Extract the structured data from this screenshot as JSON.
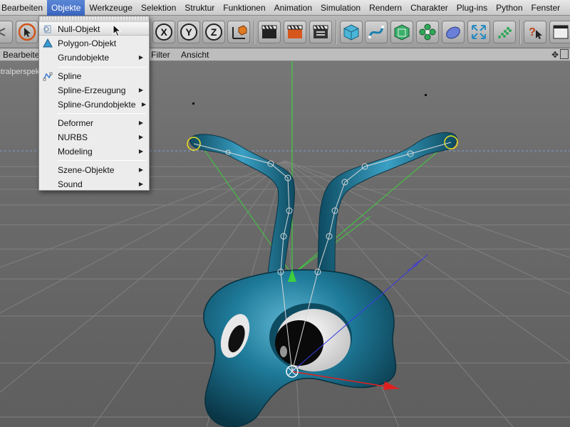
{
  "menubar": {
    "items": [
      "Bearbeiten",
      "Objekte",
      "Werkzeuge",
      "Selektion",
      "Struktur",
      "Funktionen",
      "Animation",
      "Simulation",
      "Rendern",
      "Charakter",
      "Plug-ins",
      "Python",
      "Fenster"
    ]
  },
  "viewport_menu": {
    "items": [
      "Bearbeite",
      "Filter",
      "Ansicht"
    ]
  },
  "viewport": {
    "label": "Zentralperspektive"
  },
  "axis_buttons": [
    "X",
    "Y",
    "Z"
  ],
  "objects_menu": {
    "items": [
      {
        "label": "Null-Objekt",
        "icon": "null-object-icon",
        "submenu": false
      },
      {
        "label": "Polygon-Objekt",
        "icon": "polygon-object-icon",
        "submenu": false
      },
      {
        "label": "Grundobjekte",
        "icon": "",
        "submenu": true
      },
      {
        "label": "Spline",
        "icon": "spline-icon",
        "submenu": false
      },
      {
        "label": "Spline-Erzeugung",
        "icon": "",
        "submenu": true
      },
      {
        "label": "Spline-Grundobjekte",
        "icon": "",
        "submenu": true
      },
      {
        "label": "Deformer",
        "icon": "",
        "submenu": true
      },
      {
        "label": "NURBS",
        "icon": "",
        "submenu": true
      },
      {
        "label": "Modeling",
        "icon": "",
        "submenu": true
      },
      {
        "label": "Szene-Objekte",
        "icon": "",
        "submenu": true
      },
      {
        "label": "Sound",
        "icon": "",
        "submenu": true
      }
    ],
    "highlighted": "Null-Objekt"
  },
  "colors": {
    "menu_highlight": "#3a66c0",
    "character_body": "#1e6f8c",
    "orange_accent": "#e06a1a"
  }
}
